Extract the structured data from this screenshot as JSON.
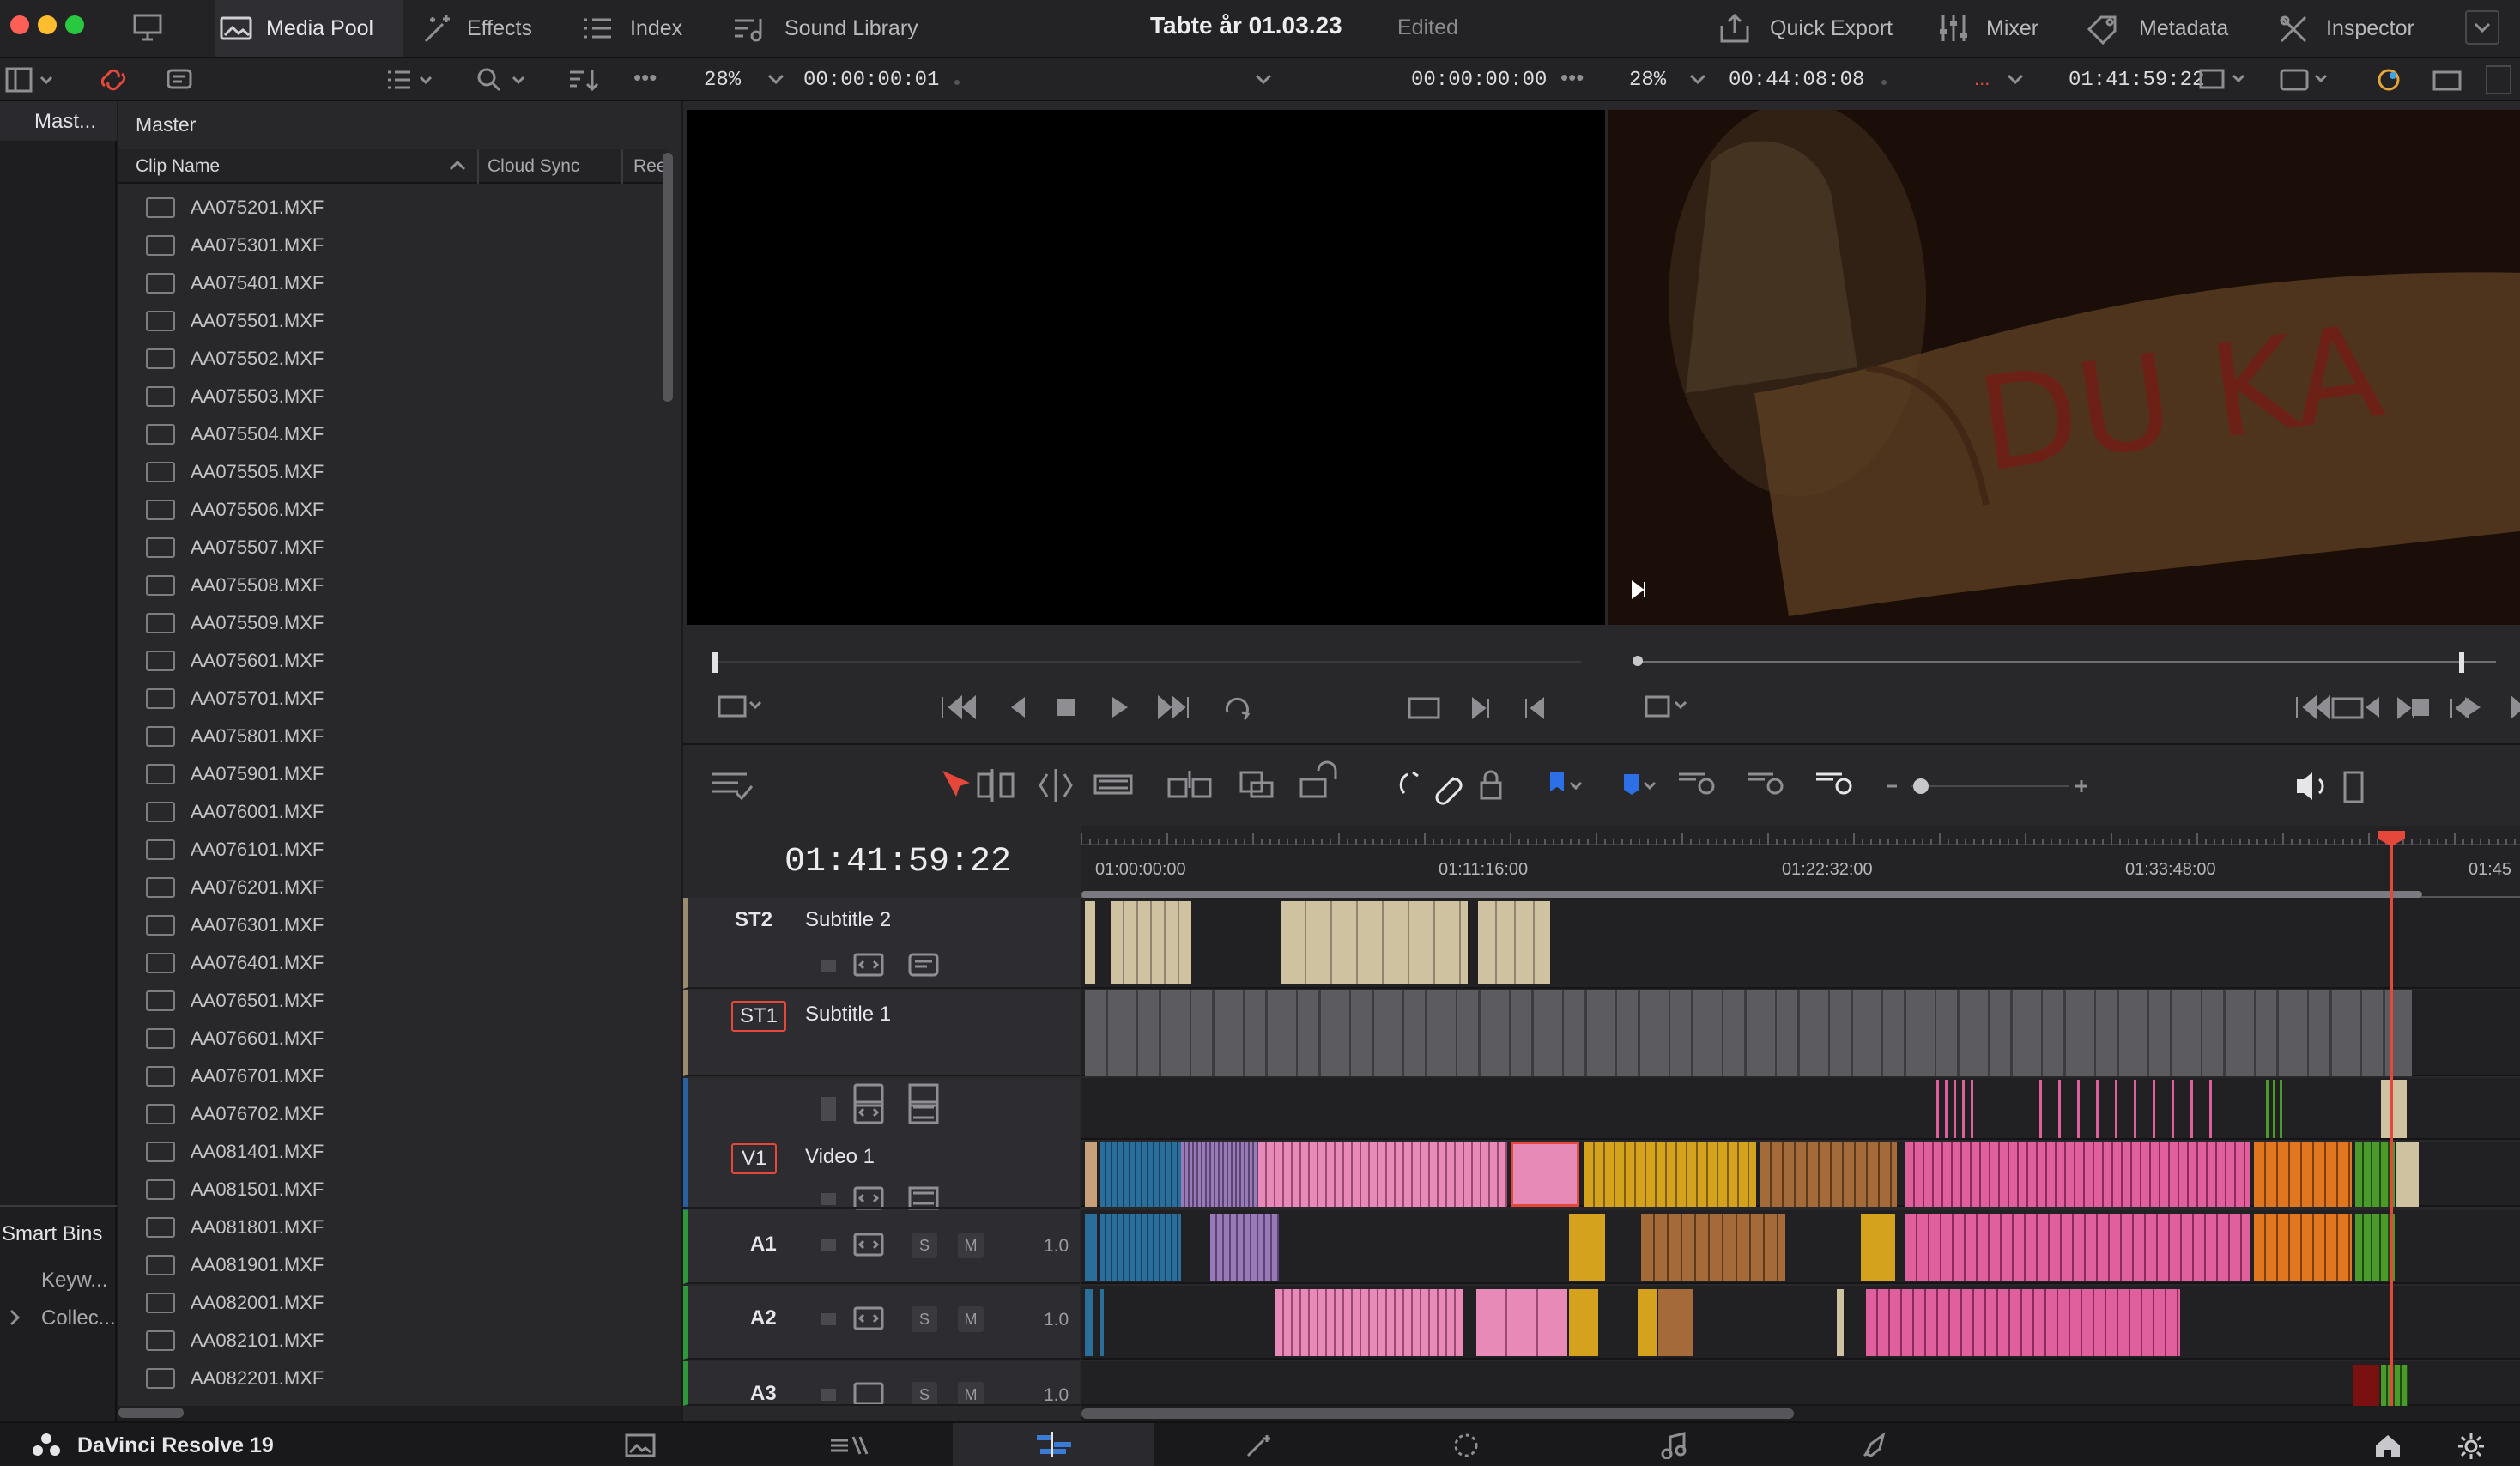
{
  "window": {
    "title": "Tabte år 01.03.23",
    "status": "Edited"
  },
  "topbar": {
    "media_pool": "Media Pool",
    "effects": "Effects",
    "index": "Index",
    "sound_library": "Sound Library",
    "quick_export": "Quick Export",
    "mixer": "Mixer",
    "metadata": "Metadata",
    "inspector": "Inspector"
  },
  "source_viewer": {
    "zoom": "28%",
    "timecode": "00:00:00:01",
    "duration": "00:00:00:00"
  },
  "timeline_viewer": {
    "zoom": "28%",
    "duration": "00:44:08:08",
    "timecode": "01:41:59:22",
    "playhead_fraction": 0.96
  },
  "sidebar": {
    "master_short": "Mast...",
    "smart_bins": "Smart Bins",
    "keywords": "Keyw...",
    "collections": "Collec..."
  },
  "media_pool": {
    "bin_title": "Master",
    "columns": [
      "Clip Name",
      "Cloud Sync",
      "Ree"
    ],
    "clips": [
      "AA075201.MXF",
      "AA075301.MXF",
      "AA075401.MXF",
      "AA075501.MXF",
      "AA075502.MXF",
      "AA075503.MXF",
      "AA075504.MXF",
      "AA075505.MXF",
      "AA075506.MXF",
      "AA075507.MXF",
      "AA075508.MXF",
      "AA075509.MXF",
      "AA075601.MXF",
      "AA075701.MXF",
      "AA075801.MXF",
      "AA075901.MXF",
      "AA076001.MXF",
      "AA076101.MXF",
      "AA076201.MXF",
      "AA076301.MXF",
      "AA076401.MXF",
      "AA076501.MXF",
      "AA076601.MXF",
      "AA076701.MXF",
      "AA076702.MXF",
      "AA081401.MXF",
      "AA081501.MXF",
      "AA081801.MXF",
      "AA081901.MXF",
      "AA082001.MXF",
      "AA082101.MXF",
      "AA082201.MXF"
    ]
  },
  "timeline": {
    "timecode": "01:41:59:22",
    "ruler": [
      "01:00:00:00",
      "01:11:16:00",
      "01:22:32:00",
      "01:33:48:00",
      "01:45"
    ],
    "tracks": {
      "st2": {
        "id": "ST2",
        "name": "Subtitle 2"
      },
      "st1": {
        "id": "ST1",
        "name": "Subtitle 1"
      },
      "v1": {
        "id": "V1",
        "name": "Video 1"
      },
      "a1": {
        "id": "A1",
        "level": "1.0"
      },
      "a2": {
        "id": "A2",
        "level": "1.0"
      },
      "a3": {
        "id": "A3",
        "level": "1.0"
      }
    },
    "solo": "S",
    "mute": "M"
  },
  "app": {
    "name": "DaVinci Resolve 19"
  },
  "colors": {
    "pink": "#e0609d",
    "blue": "#2a6f9b",
    "gold": "#d4a21c",
    "orange": "#e0761f",
    "green": "#4a9a2c",
    "beige": "#cfc2a0",
    "playhead": "#e5473a"
  }
}
